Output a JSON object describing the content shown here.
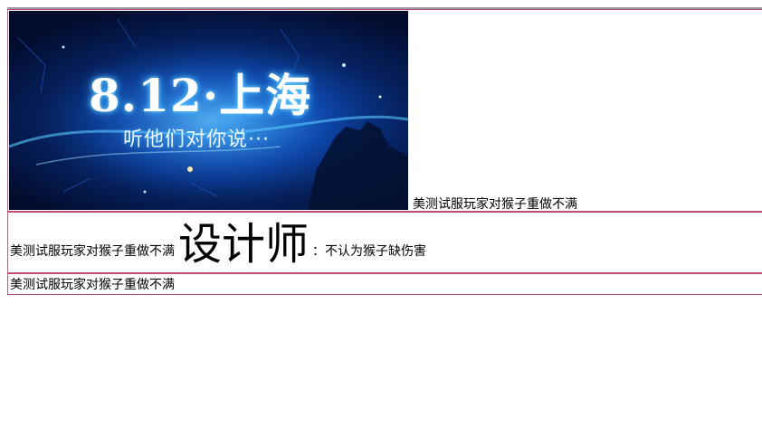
{
  "banner": {
    "title": "8.12·上海",
    "subtitle": "听他们对你说···"
  },
  "row1": {
    "caption": "美测试服玩家对猴子重做不满"
  },
  "row2": {
    "prefix": "美测试服玩家对猴子重做不满",
    "emphasis": "设计师",
    "suffix": "：不认为猴子缺伤害"
  },
  "row3": {
    "text": "美测试服玩家对猴子重做不满"
  },
  "colors": {
    "row_border": "#c24a6a",
    "banner_dark": "#020c2c",
    "banner_glow": "#1f7fe0"
  }
}
